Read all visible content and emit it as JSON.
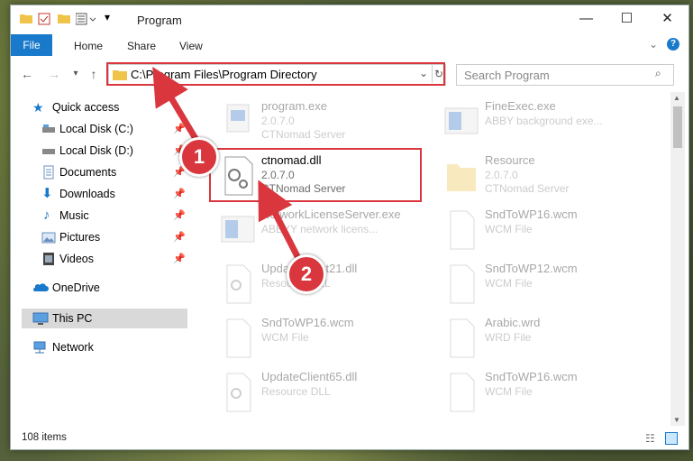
{
  "window": {
    "title": "Program"
  },
  "ribbon": {
    "tabs": [
      "File",
      "Home",
      "Share",
      "View"
    ]
  },
  "nav": {
    "address": "C:\\Program Files\\Program Directory",
    "search_placeholder": "Search Program"
  },
  "sidebar": {
    "items": [
      {
        "label": "Quick access",
        "icon": "star-icon"
      },
      {
        "label": "Local Disk (C:)",
        "icon": "drive-icon",
        "pinned": true
      },
      {
        "label": "Local Disk (D:)",
        "icon": "drive-icon",
        "pinned": true
      },
      {
        "label": "Documents",
        "icon": "documents-icon",
        "pinned": true
      },
      {
        "label": "Downloads",
        "icon": "download-icon",
        "pinned": true
      },
      {
        "label": "Music",
        "icon": "music-icon",
        "pinned": true
      },
      {
        "label": "Pictures",
        "icon": "pictures-icon",
        "pinned": true
      },
      {
        "label": "Videos",
        "icon": "videos-icon",
        "pinned": true
      },
      {
        "label": "OneDrive",
        "icon": "cloud-icon"
      },
      {
        "label": "This PC",
        "icon": "pc-icon",
        "selected": true
      },
      {
        "label": "Network",
        "icon": "network-icon"
      }
    ]
  },
  "files": [
    {
      "name": "program.exe",
      "version": "2.0.7.0",
      "desc": "CTNomad Server"
    },
    {
      "name": "FineExec.exe",
      "version": "",
      "desc": "ABBY background exe..."
    },
    {
      "name": "ctnomad.dll",
      "version": "2.0.7.0",
      "desc": "CTNomad Server"
    },
    {
      "name": "Resource",
      "version": "2.0.7.0",
      "desc": "CTNomad Server"
    },
    {
      "name": "NetworkLicenseServer.exe",
      "version": "",
      "desc": "ABBYY network licens..."
    },
    {
      "name": "SndToWP16.wcm",
      "version": "",
      "desc": "WCM File"
    },
    {
      "name": "UpdateClient21.dll",
      "version": "",
      "desc": "Resource DLL"
    },
    {
      "name": "SndToWP12.wcm",
      "version": "",
      "desc": "WCM File"
    },
    {
      "name": "SndToWP16.wcm",
      "version": "",
      "desc": "WCM File"
    },
    {
      "name": "Arabic.wrd",
      "version": "",
      "desc": "WRD File"
    },
    {
      "name": "UpdateClient65.dll",
      "version": "",
      "desc": "Resource DLL"
    },
    {
      "name": "SndToWP16.wcm",
      "version": "",
      "desc": "WCM File"
    }
  ],
  "status": {
    "count": "108 items"
  },
  "annotations": {
    "badge1": "1",
    "badge2": "2"
  },
  "colors": {
    "accent": "#1979ca",
    "highlight": "#d9363e"
  }
}
